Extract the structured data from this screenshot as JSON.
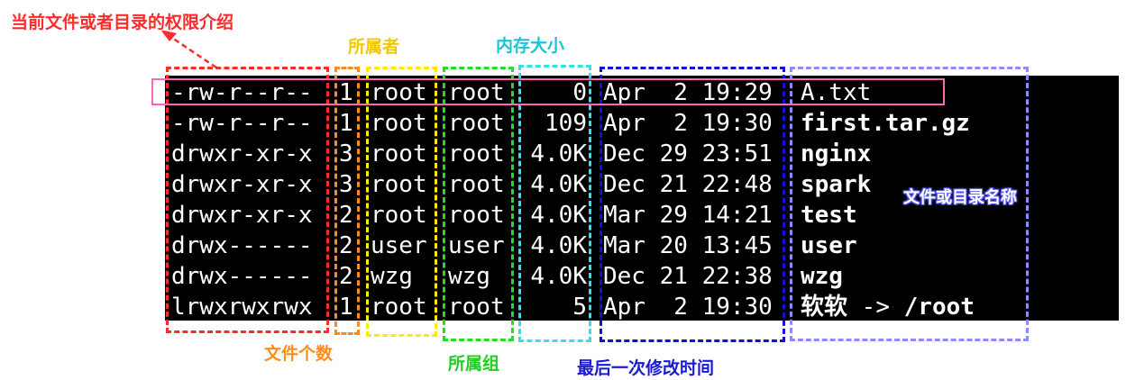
{
  "labels": {
    "permissions": "当前文件或者目录的权限介绍",
    "owner": "所属者",
    "size": "内存大小",
    "links": "文件个数",
    "group": "所属组",
    "mtime": "最后一次修改时间",
    "name": "文件或目录名称"
  },
  "rows": [
    {
      "perm": "-rw-r--r--",
      "links": "1",
      "owner": "root",
      "group": "root",
      "size": "0",
      "date": "Apr  2 19:29",
      "name": "A.txt",
      "kind": "file"
    },
    {
      "perm": "-rw-r--r--",
      "links": "1",
      "owner": "root",
      "group": "root",
      "size": "109",
      "date": "Apr  2 19:30",
      "name": "first.tar.gz",
      "kind": "archive"
    },
    {
      "perm": "drwxr-xr-x",
      "links": "3",
      "owner": "root",
      "group": "root",
      "size": "4.0K",
      "date": "Dec 29 23:51",
      "name": "nginx",
      "kind": "dir"
    },
    {
      "perm": "drwxr-xr-x",
      "links": "3",
      "owner": "root",
      "group": "root",
      "size": "4.0K",
      "date": "Dec 21 22:48",
      "name": "spark",
      "kind": "dir"
    },
    {
      "perm": "drwxr-xr-x",
      "links": "2",
      "owner": "root",
      "group": "root",
      "size": "4.0K",
      "date": "Mar 29 14:21",
      "name": "test",
      "kind": "dir"
    },
    {
      "perm": "drwx------",
      "links": "2",
      "owner": "user",
      "group": "user",
      "size": "4.0K",
      "date": "Mar 20 13:45",
      "name": "user",
      "kind": "dir"
    },
    {
      "perm": "drwx------",
      "links": "2",
      "owner": "wzg",
      "group": "wzg",
      "size": "4.0K",
      "date": "Dec 21 22:38",
      "name": "wzg",
      "kind": "dir"
    },
    {
      "perm": "lrwxrwxrwx",
      "links": "1",
      "owner": "root",
      "group": "root",
      "size": "5",
      "date": "Apr  2 19:30",
      "name": "软软",
      "kind": "link",
      "arrow": " -> ",
      "target": "/root"
    }
  ],
  "colors": {
    "permissions_box": "#ff2a2a",
    "links_box": "#ff8c1a",
    "owner_box": "#ffea00",
    "group_box": "#22dd22",
    "size_box": "#33e0e6",
    "mtime_box": "#1010dd",
    "name_box": "#8c8cff",
    "highlight_box": "#ff66b3",
    "label_red": "#ff2a2a",
    "label_yellow": "#f0c800",
    "label_cyan": "#19c6d6",
    "label_orange": "#ff8c1a",
    "label_green": "#22cc22",
    "label_blue": "#1a1ad6",
    "label_name": "#ffffff"
  }
}
